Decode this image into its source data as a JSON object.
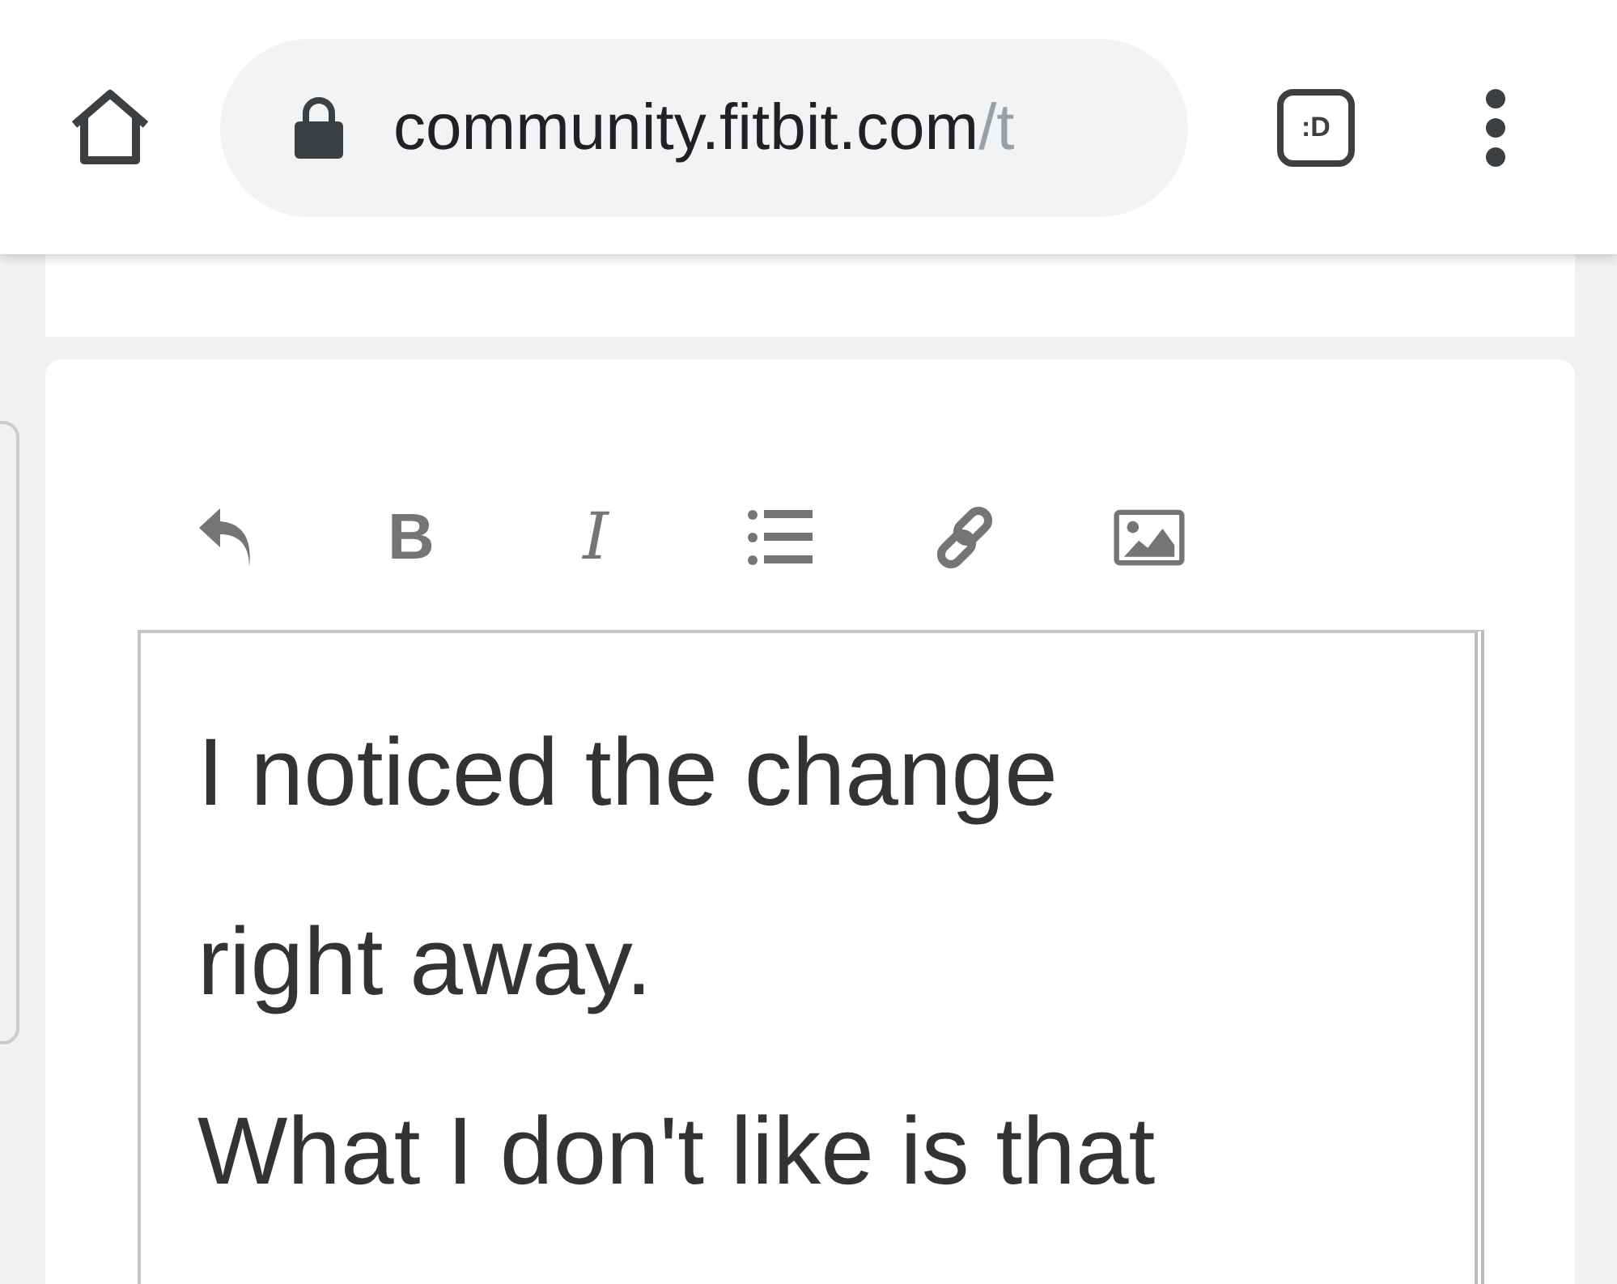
{
  "browser": {
    "host": "community.fitbit.com",
    "path": "/t",
    "tab_count": ":D"
  },
  "toolbar": [
    {
      "kind": "undo"
    },
    {
      "kind": "bold",
      "label": "B"
    },
    {
      "kind": "italic",
      "label": "I"
    },
    {
      "kind": "list"
    },
    {
      "kind": "link"
    },
    {
      "kind": "image"
    }
  ],
  "editor": {
    "lines": [
      "I noticed the change",
      "right away.",
      "What I don't like is that"
    ]
  }
}
